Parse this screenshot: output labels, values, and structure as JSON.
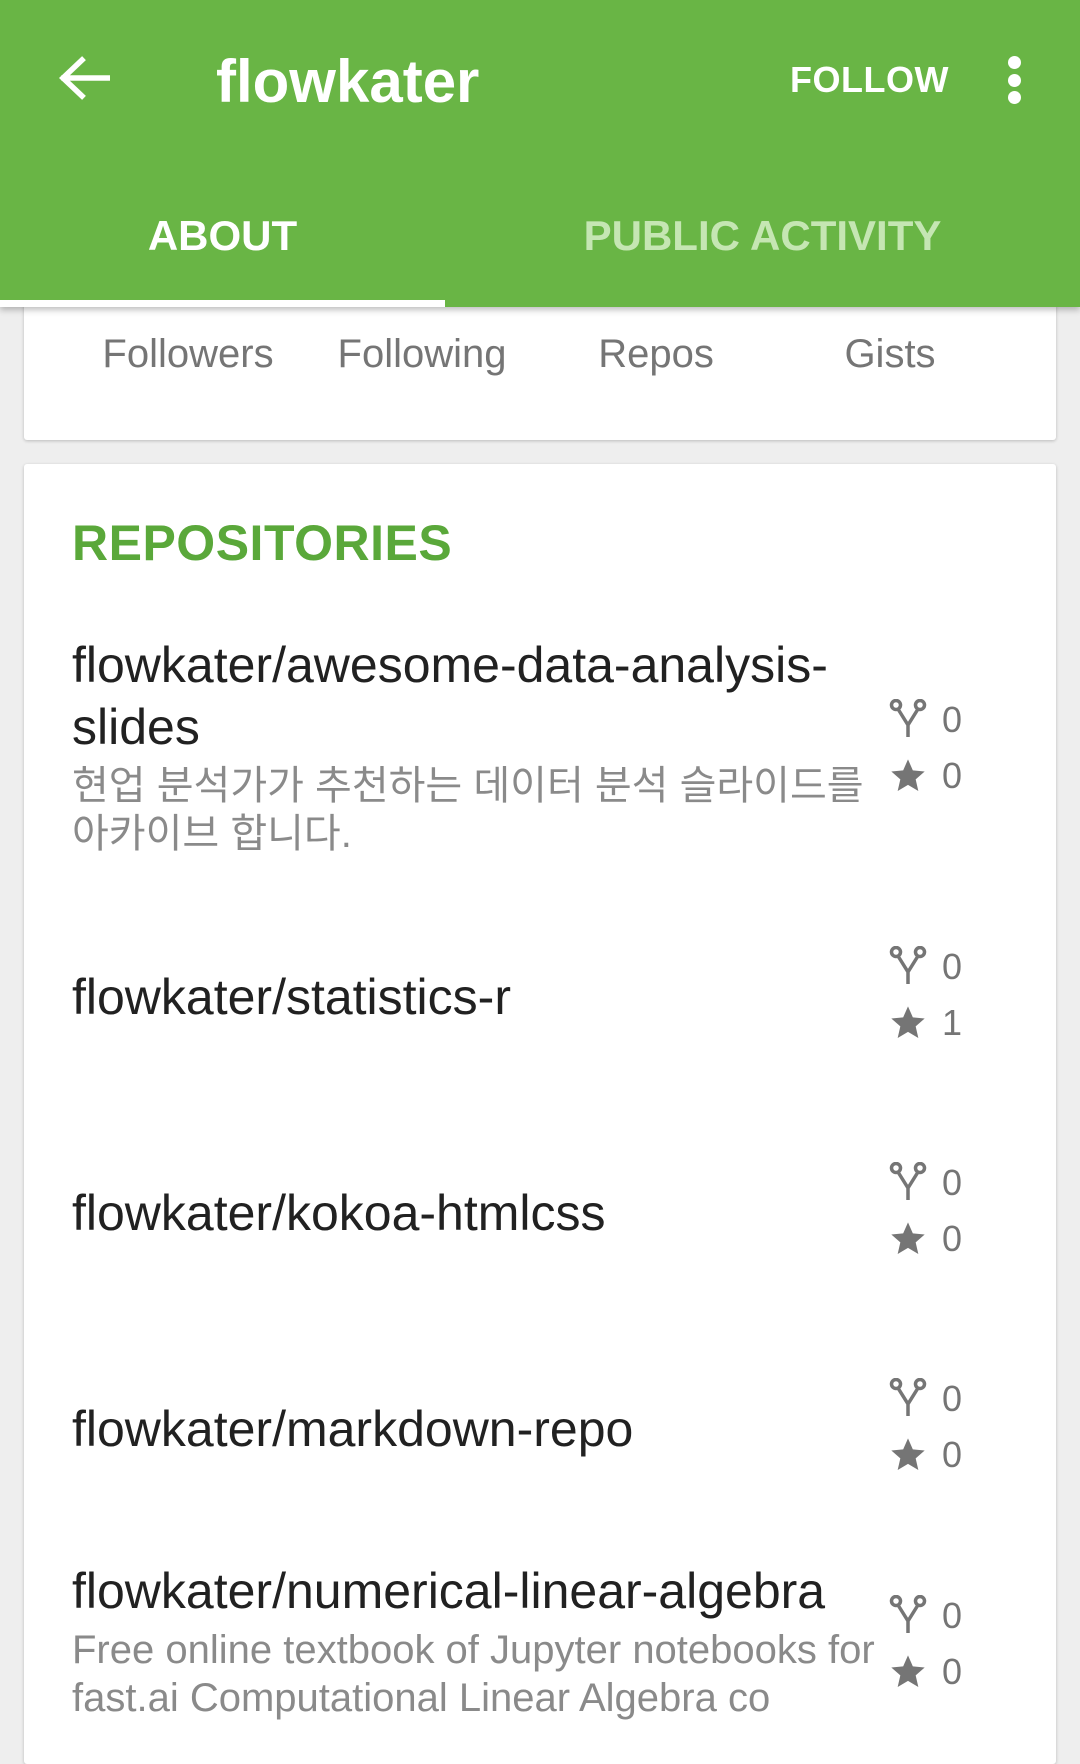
{
  "appbar": {
    "title": "flowkater",
    "follow_label": "FOLLOW",
    "tabs": [
      {
        "label": "ABOUT"
      },
      {
        "label": "PUBLIC ACTIVITY"
      }
    ]
  },
  "stats": {
    "followers_label": "Followers",
    "following_label": "Following",
    "repos_label": "Repos",
    "gists_label": "Gists"
  },
  "repositories": {
    "title": "REPOSITORIES",
    "items": [
      {
        "name": "flowkater/awesome-data-analysis-slides",
        "description": "현업 분석가가 추천하는 데이터 분석 슬라이드를 아카이브 합니다.",
        "forks": "0",
        "stars": "0"
      },
      {
        "name": "flowkater/statistics-r",
        "description": "",
        "forks": "0",
        "stars": "1"
      },
      {
        "name": "flowkater/kokoa-htmlcss",
        "description": "",
        "forks": "0",
        "stars": "0"
      },
      {
        "name": "flowkater/markdown-repo",
        "description": "",
        "forks": "0",
        "stars": "0"
      },
      {
        "name": "flowkater/numerical-linear-algebra",
        "description": "Free online textbook of Jupyter notebooks for fast.ai Computational Linear Algebra co",
        "forks": "0",
        "stars": "0"
      }
    ]
  },
  "colors": {
    "primary": "#69b545",
    "accent_text": "#5aa83a"
  },
  "icons": [
    "back-arrow-icon",
    "more-vert-icon",
    "fork-icon",
    "star-icon"
  ]
}
